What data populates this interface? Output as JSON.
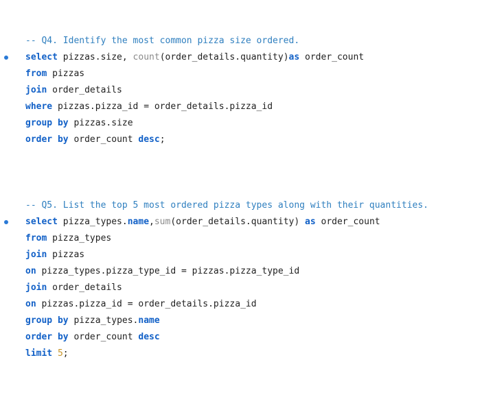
{
  "editor": {
    "block1": {
      "comment": "-- Q4. Identify the most common pizza size ordered.",
      "l1": {
        "kw1": "select",
        "t1": " pizzas.size, ",
        "fn1": "count",
        "t2": "(order_details.quantity)",
        "kw2": "as",
        "t3": " order_count"
      },
      "l2": {
        "kw1": "from",
        "t1": " pizzas"
      },
      "l3": {
        "kw1": "join",
        "t1": " order_details"
      },
      "l4": {
        "kw1": "where",
        "t1": " pizzas.pizza_id = order_details.pizza_id"
      },
      "l5": {
        "kw1": "group by",
        "t1": " pizzas.size"
      },
      "l6": {
        "kw1": "order by",
        "t1": " order_count ",
        "kw2": "desc",
        "t2": ";"
      }
    },
    "block2": {
      "comment": "-- Q5. List the top 5 most ordered pizza types along with their quantities.",
      "l1": {
        "kw1": "select",
        "t1": " pizza_types.",
        "kw2": "name",
        "t2": ",",
        "fn1": "sum",
        "t3": "(order_details.quantity) ",
        "kw3": "as",
        "t4": " order_count"
      },
      "l2": {
        "kw1": "from",
        "t1": " pizza_types"
      },
      "l3": {
        "kw1": "join",
        "t1": " pizzas"
      },
      "l4": {
        "kw1": "on",
        "t1": " pizza_types.pizza_type_id = pizzas.pizza_type_id"
      },
      "l5": {
        "kw1": "join",
        "t1": " order_details"
      },
      "l6": {
        "kw1": "on",
        "t1": " pizzas.pizza_id = order_details.pizza_id"
      },
      "l7": {
        "kw1": "group by",
        "t1": " pizza_types.",
        "kw2": "name"
      },
      "l8": {
        "kw1": "order by",
        "t1": " order_count ",
        "kw2": "desc"
      },
      "l9": {
        "kw1": "limit",
        "t1": " ",
        "num1": "5",
        "t2": ";"
      }
    }
  }
}
